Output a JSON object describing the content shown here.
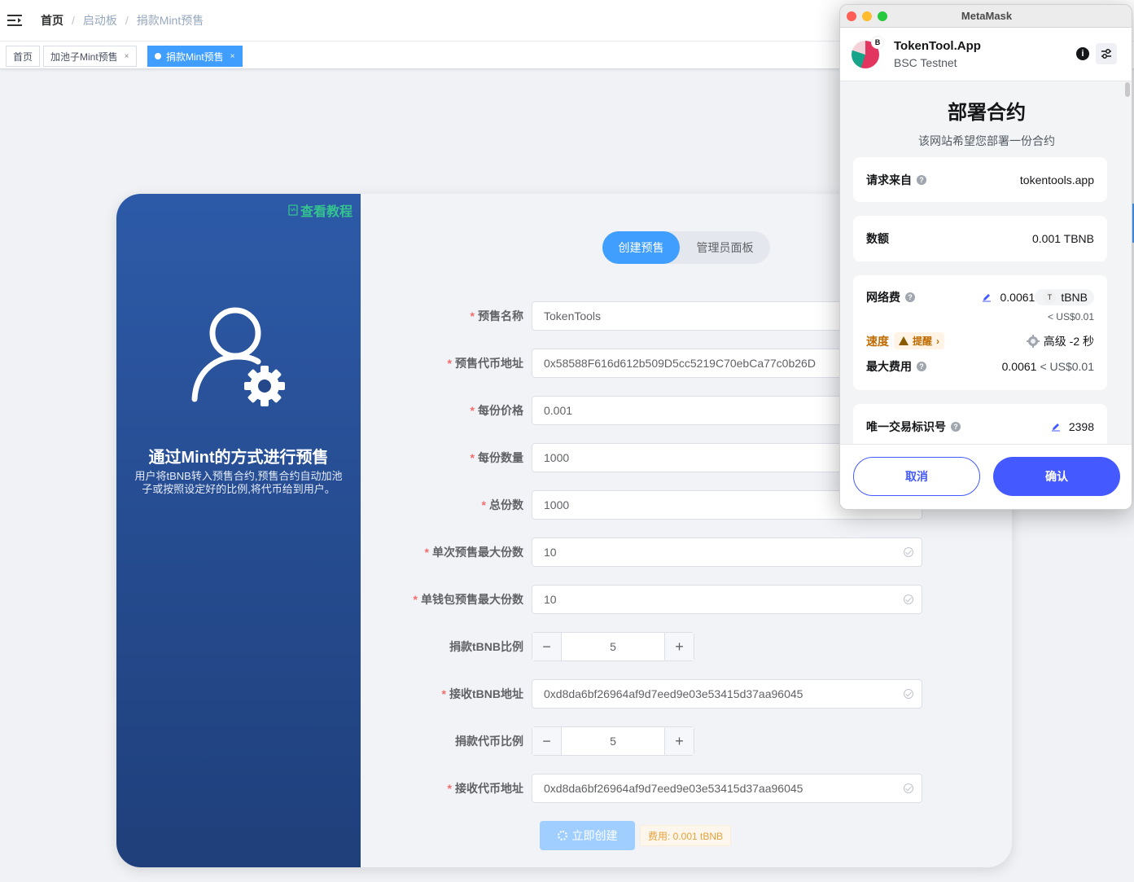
{
  "breadcrumb": [
    "首页",
    "启动板",
    "捐款Mint预售"
  ],
  "tags": [
    {
      "label": "首页",
      "closable": false
    },
    {
      "label": "加池子Mint预售",
      "closable": true
    },
    {
      "label": "捐款Mint预售",
      "closable": true,
      "active": true
    }
  ],
  "tag_close": "×",
  "left_panel": {
    "tutorial": "查看教程",
    "title": "通过Mint的方式进行预售",
    "desc": "用户将tBNB转入预售合约,预售合约自动加池子或按照设定好的比例,将代币给到用户。"
  },
  "mode_switch": {
    "active": "创建预售",
    "other": "管理员面板"
  },
  "form": {
    "name": {
      "label": "预售名称",
      "value": "TokenTools",
      "required": true
    },
    "token_address": {
      "label": "预售代币地址",
      "value": "0x58588F616d612b509D5cc5219C70ebCa77c0b26D",
      "required": true
    },
    "price": {
      "label": "每份价格",
      "value": "0.001",
      "required": true
    },
    "amount": {
      "label": "每份数量",
      "value": "1000",
      "required": true
    },
    "total": {
      "label": "总份数",
      "value": "1000",
      "required": true
    },
    "max_single": {
      "label": "单次预售最大份数",
      "value": "10",
      "required": true
    },
    "max_wallet": {
      "label": "单钱包预售最大份数",
      "value": "10",
      "required": true
    },
    "tbnb_ratio": {
      "label": "捐款tBNB比例",
      "value": "5"
    },
    "tbnb_receiver": {
      "label": "接收tBNB地址",
      "value": "0xd8da6bf26964af9d7eed9e03e53415d37aa96045",
      "required": true
    },
    "token_ratio": {
      "label": "捐款代币比例",
      "value": "5"
    },
    "token_receiver": {
      "label": "接收代币地址",
      "value": "0xd8da6bf26964af9d7eed9e03e53415d37aa96045",
      "required": true
    }
  },
  "stepper": {
    "minus": "−",
    "plus": "+"
  },
  "req_mark": "*",
  "create_button": "立即创建",
  "fee_tag": "费用: 0.001 tBNB",
  "metamask": {
    "window_title": "MetaMask",
    "site_name": "TokenTool.App",
    "network": "BSC Testnet",
    "site_badge": "B",
    "info_glyph": "i",
    "heading": "部署合约",
    "subheading": "该网站希望您部署一份合约",
    "request_from_label": "请求来自",
    "request_from_value": "tokentools.app",
    "amount_label": "数额",
    "amount_value": "0.001 TBNB",
    "network_fee_label": "网络费",
    "network_fee_value": "0.0061",
    "network_fee_token_glyph": "T",
    "network_fee_token": "tBNB",
    "network_fee_usd": "< US$0.01",
    "speed_label": "速度",
    "speed_warning": "提醒",
    "speed_chevron": "›",
    "speed_value": "高级 -2 秒",
    "max_fee_label": "最大费用",
    "max_fee_value": "0.0061",
    "max_fee_usd": "< US$0.01",
    "nonce_label": "唯一交易标识号",
    "nonce_value": "2398",
    "help_glyph": "?",
    "cancel": "取消",
    "confirm": "确认",
    "colors": {
      "primary": "#4459ff",
      "warning": "#c06b00"
    }
  }
}
